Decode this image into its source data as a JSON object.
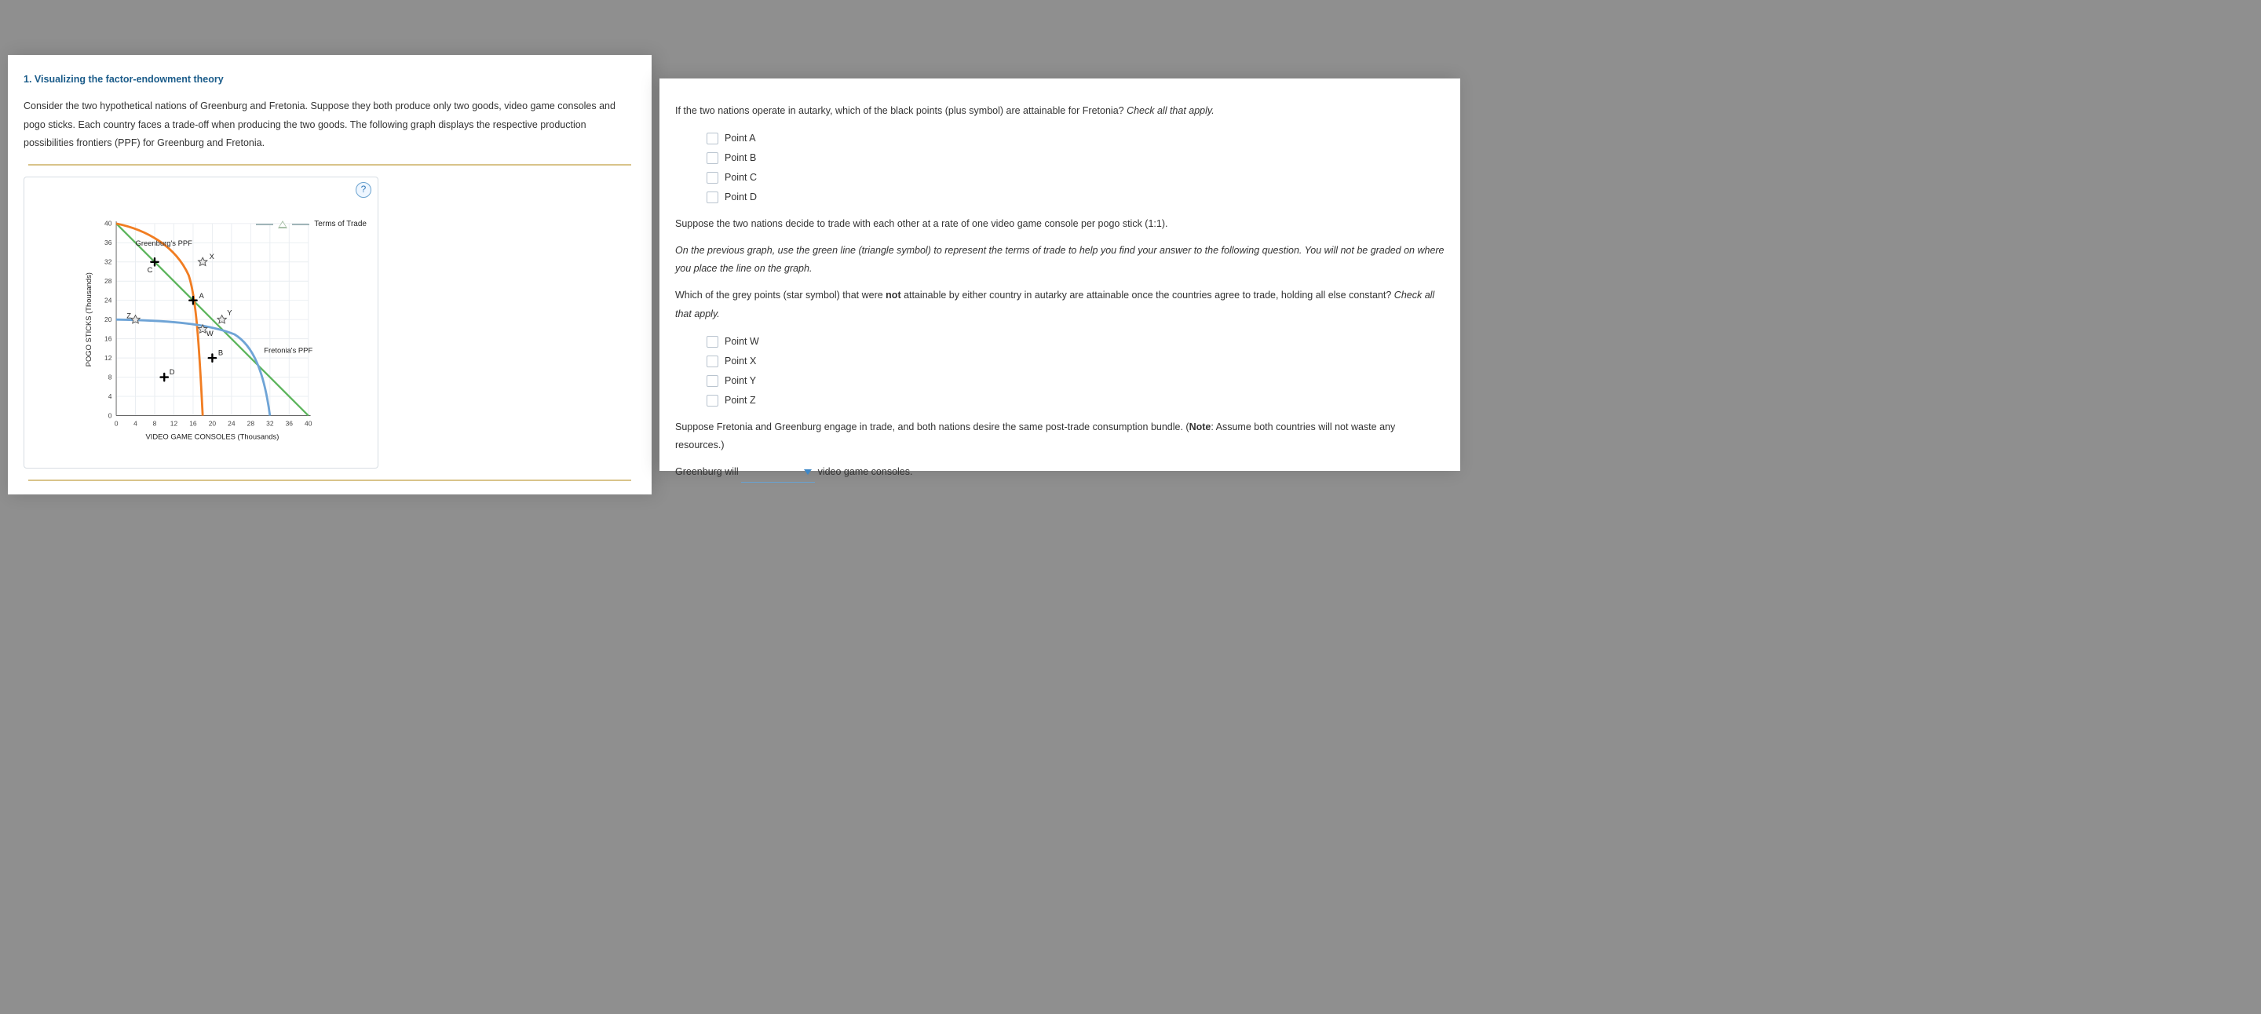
{
  "header": {
    "number": "1.",
    "title": "Visualizing the factor-endowment theory"
  },
  "intro": "Consider the two hypothetical nations of Greenburg and Fretonia. Suppose they both produce only two goods, video game consoles and pogo sticks. Each country faces a trade-off when producing the two goods. The following graph displays the respective production possibilities frontiers (PPF) for Greenburg and Fretonia.",
  "legend": {
    "terms_of_trade": "Terms of Trade",
    "greenburg": "Greenburg's PPF",
    "fretonia": "Fretonia's PPF"
  },
  "axes": {
    "x": "VIDEO GAME CONSOLES (Thousands)",
    "y": "POGO STICKS (Thousands)",
    "ticks": [
      "0",
      "4",
      "8",
      "12",
      "16",
      "20",
      "24",
      "28",
      "32",
      "36",
      "40"
    ]
  },
  "chart_data": {
    "type": "line",
    "xlim": [
      0,
      40
    ],
    "ylim": [
      0,
      40
    ],
    "series": [
      {
        "name": "Greenburg's PPF",
        "color": "#f17d22",
        "points": [
          [
            0,
            40
          ],
          [
            8,
            38
          ],
          [
            12,
            35
          ],
          [
            14,
            32
          ],
          [
            16,
            26
          ],
          [
            17,
            18
          ],
          [
            17.5,
            8
          ],
          [
            18,
            0
          ]
        ]
      },
      {
        "name": "Fretonia's PPF",
        "color": "#6fa4d6",
        "points": [
          [
            0,
            20
          ],
          [
            8,
            19.5
          ],
          [
            16,
            19
          ],
          [
            22,
            17
          ],
          [
            26,
            14
          ],
          [
            29,
            10
          ],
          [
            31,
            5
          ],
          [
            32,
            0
          ]
        ]
      },
      {
        "name": "Terms of Trade (1:1)",
        "color": "#5db55d",
        "points": [
          [
            0,
            40
          ],
          [
            40,
            0
          ]
        ]
      }
    ],
    "black_points": [
      {
        "label": "A",
        "x": 16,
        "y": 24
      },
      {
        "label": "B",
        "x": 20,
        "y": 12
      },
      {
        "label": "C",
        "x": 8,
        "y": 32
      },
      {
        "label": "D",
        "x": 10,
        "y": 8
      }
    ],
    "grey_points": [
      {
        "label": "W",
        "x": 18,
        "y": 18
      },
      {
        "label": "X",
        "x": 18,
        "y": 32
      },
      {
        "label": "Y",
        "x": 22,
        "y": 20
      },
      {
        "label": "Z",
        "x": 4,
        "y": 20
      }
    ]
  },
  "q1": {
    "prompt_a": "If the two nations operate in autarky, which of the black points (plus symbol) are attainable for Fretonia? ",
    "prompt_b": "Check all that apply.",
    "opts": [
      "Point A",
      "Point B",
      "Point C",
      "Point D"
    ]
  },
  "tot_para_a": "Suppose the two nations decide to trade with each other at a rate of one video game console per pogo stick (1:1).",
  "tot_para_b": "On the previous graph, use the green line (triangle symbol) to represent the terms of trade to help you find your answer to the following question. You will not be graded on where you place the line on the graph.",
  "q2": {
    "prompt_a1": "Which of the grey points (star symbol) that were ",
    "prompt_not": "not",
    "prompt_a2": " attainable by either country in autarky are attainable once the countries agree to trade, holding all else constant? ",
    "prompt_b": "Check all that apply.",
    "opts": [
      "Point W",
      "Point X",
      "Point Y",
      "Point Z"
    ]
  },
  "q3": {
    "para_a": "Suppose Fretonia and Greenburg engage in trade, and both nations desire the same post-trade consumption bundle. (",
    "note_label": "Note",
    "para_b": ": Assume both countries will not waste any resources.)",
    "sent_a": "Greenburg will ",
    "blank": "",
    "sent_b": " video game consoles."
  },
  "help": "?"
}
